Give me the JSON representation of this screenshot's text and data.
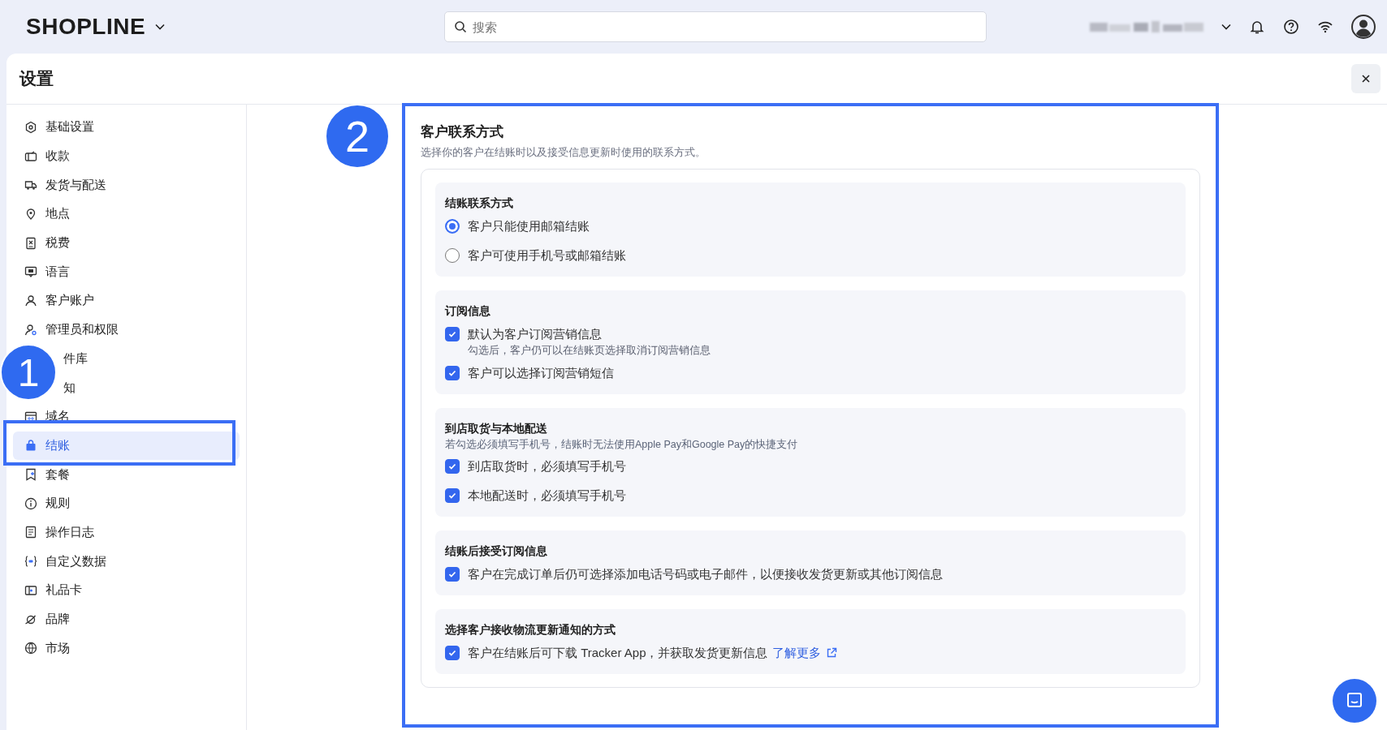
{
  "topbar": {
    "logo": "SHOPLINE",
    "search": {
      "placeholder": "搜索"
    }
  },
  "page": {
    "title": "设置"
  },
  "sidebar": {
    "items": [
      {
        "label": "基础设置",
        "selected": false,
        "covered": false
      },
      {
        "label": "收款",
        "selected": false,
        "covered": false
      },
      {
        "label": "发货与配送",
        "selected": false,
        "covered": false
      },
      {
        "label": "地点",
        "selected": false,
        "covered": false
      },
      {
        "label": "税费",
        "selected": false,
        "covered": false
      },
      {
        "label": "语言",
        "selected": false,
        "covered": false
      },
      {
        "label": "客户账户",
        "selected": false,
        "covered": false
      },
      {
        "label": "管理员和权限",
        "selected": false,
        "covered": false
      },
      {
        "label": "件库",
        "selected": false,
        "covered": true
      },
      {
        "label": "知",
        "selected": false,
        "covered": true
      },
      {
        "label": "域名",
        "selected": false,
        "covered": false
      },
      {
        "label": "结账",
        "selected": true,
        "covered": false
      },
      {
        "label": "套餐",
        "selected": false,
        "covered": false
      },
      {
        "label": "规则",
        "selected": false,
        "covered": false
      },
      {
        "label": "操作日志",
        "selected": false,
        "covered": false
      },
      {
        "label": "自定义数据",
        "selected": false,
        "covered": false
      },
      {
        "label": "礼品卡",
        "selected": false,
        "covered": false
      },
      {
        "label": "品牌",
        "selected": false,
        "covered": false
      },
      {
        "label": "市场",
        "selected": false,
        "covered": false
      }
    ]
  },
  "section": {
    "title": "客户联系方式",
    "description": "选择你的客户在结账时以及接受信息更新时使用的联系方式。",
    "groups": [
      {
        "title": "结账联系方式",
        "options": [
          {
            "kind": "radio",
            "label": "客户只能使用邮箱结账",
            "selected": true
          },
          {
            "kind": "radio",
            "label": "客户可使用手机号或邮箱结账",
            "selected": false
          }
        ]
      },
      {
        "title": "订阅信息",
        "options": [
          {
            "kind": "checkbox",
            "label": "默认为客户订阅营销信息",
            "checked": true,
            "hint": "勾选后，客户仍可以在结账页选择取消订阅营销信息"
          },
          {
            "kind": "checkbox",
            "label": "客户可以选择订阅营销短信",
            "checked": true
          }
        ]
      },
      {
        "title": "到店取货与本地配送",
        "description": "若勾选必须填写手机号，结账时无法使用Apple Pay和Google Pay的快捷支付",
        "options": [
          {
            "kind": "checkbox",
            "label": "到店取货时，必须填写手机号",
            "checked": true
          },
          {
            "kind": "checkbox",
            "label": "本地配送时，必须填写手机号",
            "checked": true
          }
        ]
      },
      {
        "title": "结账后接受订阅信息",
        "options": [
          {
            "kind": "checkbox",
            "label": "客户在完成订单后仍可选择添加电话号码或电子邮件，以便接收发货更新或其他订阅信息",
            "checked": true
          }
        ]
      },
      {
        "title": "选择客户接收物流更新通知的方式",
        "options": [
          {
            "kind": "checkbox",
            "label": "客户在结账后可下载 Tracker App，并获取发货更新信息",
            "checked": true,
            "link": "了解更多"
          }
        ]
      }
    ]
  },
  "annotations": [
    {
      "label": "1"
    },
    {
      "label": "2"
    }
  ]
}
